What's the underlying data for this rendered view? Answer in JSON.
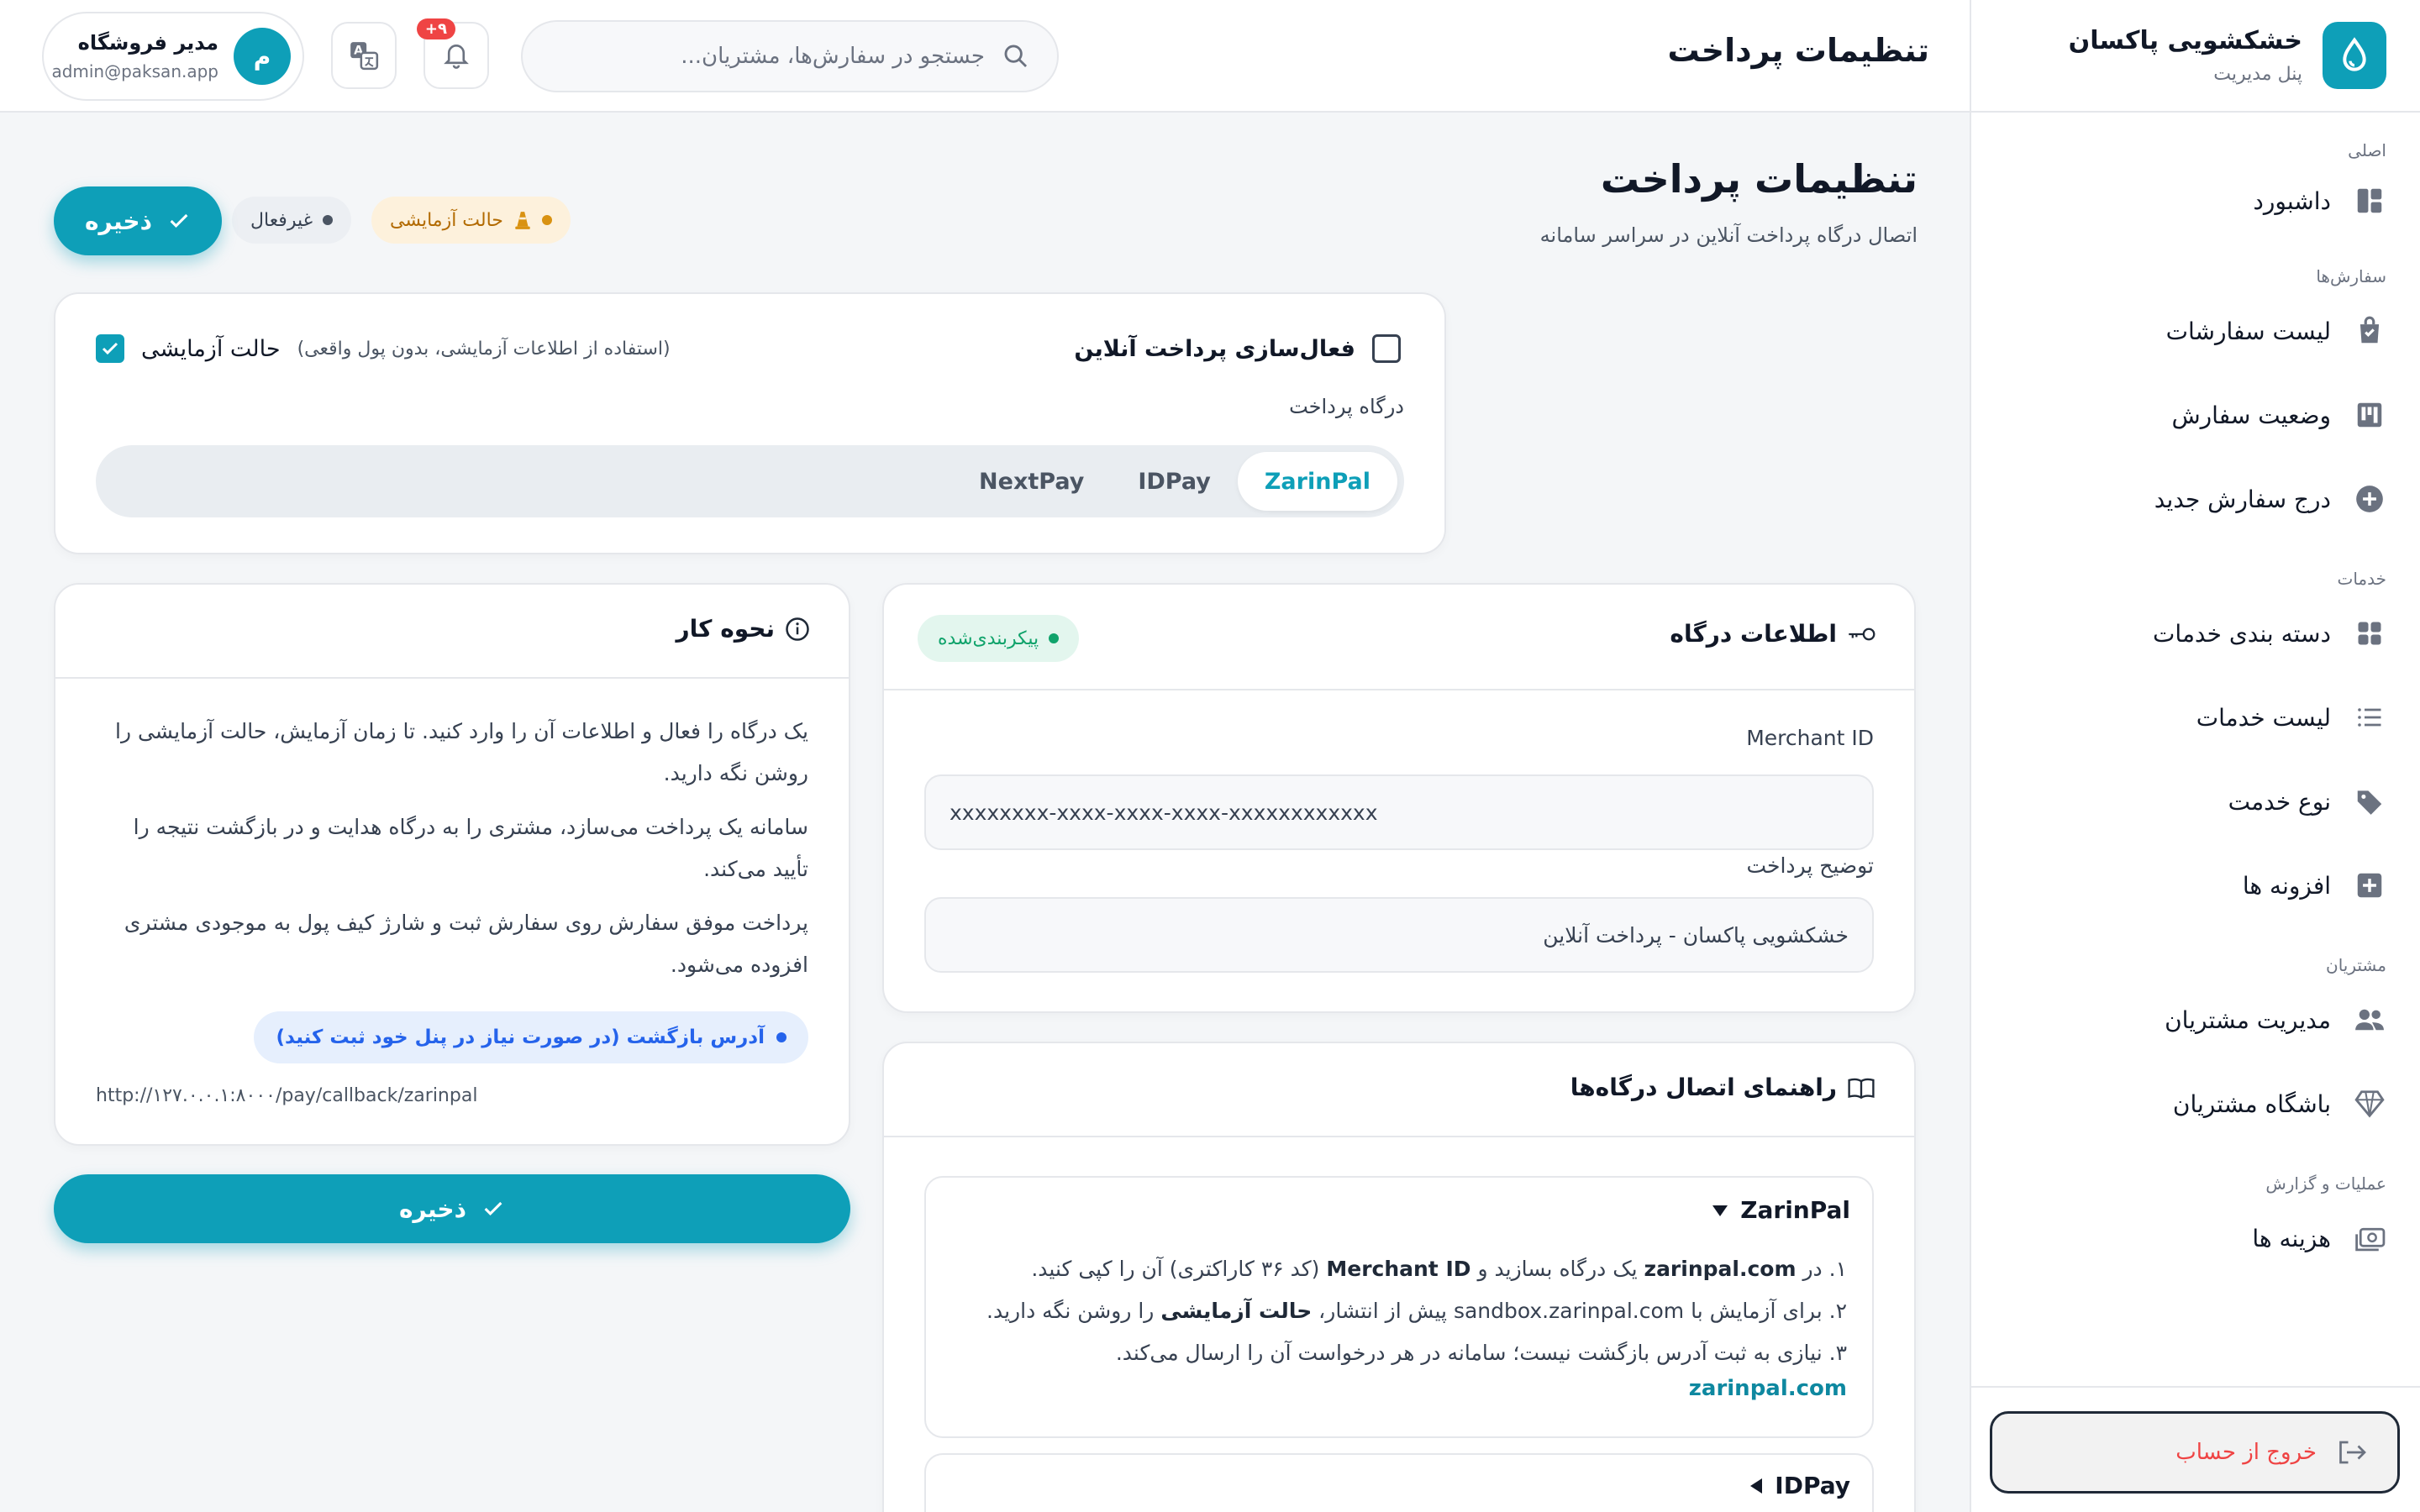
{
  "brand": {
    "title": "خشکشویی پاکسان",
    "subtitle": "پنل مدیریت"
  },
  "sidebar": {
    "sections": [
      {
        "label": "اصلی",
        "items": [
          {
            "label": "داشبورد",
            "icon": "dashboard-icon"
          }
        ]
      },
      {
        "label": "سفارش‌ها",
        "items": [
          {
            "label": "لیست سفارشات",
            "icon": "shopping-bag-icon"
          },
          {
            "label": "وضعیت سفارش",
            "icon": "kanban-icon"
          },
          {
            "label": "درج سفارش جدید",
            "icon": "plus-circle-icon"
          }
        ]
      },
      {
        "label": "خدمات",
        "items": [
          {
            "label": "دسته بندی خدمات",
            "icon": "grid-icon"
          },
          {
            "label": "لیست خدمات",
            "icon": "list-icon"
          },
          {
            "label": "نوع خدمت",
            "icon": "tag-icon"
          },
          {
            "label": "افزونه ها",
            "icon": "plus-square-icon"
          }
        ]
      },
      {
        "label": "مشتریان",
        "items": [
          {
            "label": "مدیریت مشتریان",
            "icon": "users-icon"
          },
          {
            "label": "باشگاه مشتریان",
            "icon": "diamond-icon"
          }
        ]
      },
      {
        "label": "عملیات و گزارش",
        "items": [
          {
            "label": "هزینه ها",
            "icon": "money-icon"
          }
        ]
      }
    ],
    "logout_label": "خروج از حساب"
  },
  "header": {
    "title": "تنظیمات پرداخت",
    "search_placeholder": "جستجو در سفارش‌ها، مشتریان...",
    "notification_badge": "+۹",
    "user": {
      "name": "مدیر فروشگاه",
      "email": "admin@paksan.app",
      "avatar_letter": "م"
    }
  },
  "page": {
    "title": "تنظیمات پرداخت",
    "subtitle": "اتصال درگاه پرداخت آنلاین در سراسر سامانه",
    "status_test": "حالت آزمایشی",
    "status_off": "غیرفعال",
    "save_label": "ذخیره"
  },
  "settings": {
    "online_payment_label": "فعال‌سازی پرداخت آنلاین",
    "online_payment_checked": false,
    "test_mode_label": "حالت آزمایشی",
    "test_mode_hint": "(استفاده از اطلاعات آزمایشی، بدون پول واقعی)",
    "test_mode_checked": true,
    "gateway_label": "درگاه پرداخت",
    "gateways": [
      "ZarinPal",
      "IDPay",
      "NextPay"
    ],
    "active_gateway": "ZarinPal"
  },
  "gateway_info": {
    "title": "اطلاعات درگاه",
    "status_badge": "پیکربندی‌شده",
    "merchant_label": "Merchant ID",
    "merchant_value": "xxxxxxxx-xxxx-xxxx-xxxx-xxxxxxxxxxxx",
    "description_label": "توضیح پرداخت",
    "description_value": "خشکشویی پاکسان - پرداخت آنلاین"
  },
  "how_it_works": {
    "title": "نحوه کار",
    "paragraphs": [
      "یک درگاه را فعال و اطلاعات آن را وارد کنید. تا زمان آزمایش، حالت آزمایشی را روشن نگه دارید.",
      "سامانه یک پرداخت می‌سازد، مشتری را به درگاه هدایت و در بازگشت نتیجه را تأیید می‌کند.",
      "پرداخت موفق سفارش روی سفارش ثبت و شارژ کیف پول به موجودی مشتری افزوده می‌شود."
    ],
    "callback_label": "آدرس بازگشت (در صورت نیاز در پنل خود ثبت کنید)",
    "callback_url": "http://۱۲۷.۰.۰.۱:۸۰۰۰/pay/callback/zarinpal"
  },
  "guide": {
    "title": "راهنمای اتصال درگاه‌ها",
    "zarinpal": {
      "name": "ZarinPal",
      "line1": {
        "a": "۱. در ",
        "b": "zarinpal.com",
        "c": " یک درگاه بسازید و ",
        "d": "Merchant ID",
        "e": " (کد ۳۶ کاراکتری) آن را کپی کنید."
      },
      "line2": {
        "a": "۲. برای آزمایش با sandbox.zarinpal.com پیش از انتشار، ",
        "b": "حالت آزمایشی",
        "c": " را روشن نگه دارید."
      },
      "line3": "۳. نیازی به ثبت آدرس بازگشت نیست؛ سامانه در هر درخواست آن را ارسال می‌کند.",
      "link": "zarinpal.com"
    },
    "idpay": {
      "name": "IDPay"
    }
  },
  "colors": {
    "accent": "#0e9fb8",
    "danger": "#ef4444",
    "success": "#10a36b",
    "warning": "#b26a00"
  }
}
